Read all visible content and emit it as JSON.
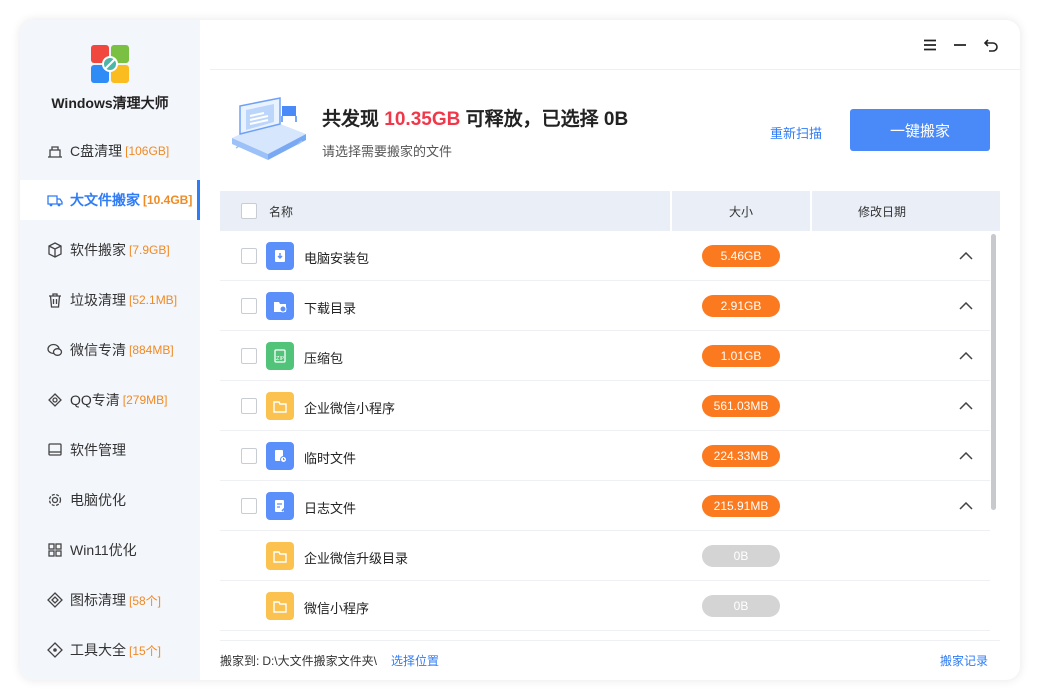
{
  "app": {
    "title": "Windows清理大师"
  },
  "sidebar": {
    "items": [
      {
        "label": "C盘清理",
        "count": "[106GB]",
        "icon": "broom-icon",
        "active": false
      },
      {
        "label": "大文件搬家",
        "count": "[10.4GB]",
        "icon": "truck-icon",
        "active": true
      },
      {
        "label": "软件搬家",
        "count": "[7.9GB]",
        "icon": "box-icon",
        "active": false
      },
      {
        "label": "垃圾清理",
        "count": "[52.1MB]",
        "icon": "trash-icon",
        "active": false
      },
      {
        "label": "微信专清",
        "count": "[884MB]",
        "icon": "wechat-icon",
        "active": false
      },
      {
        "label": "QQ专清",
        "count": "[279MB]",
        "icon": "qq-icon",
        "active": false
      },
      {
        "label": "软件管理",
        "count": "",
        "icon": "monitor-icon",
        "active": false
      },
      {
        "label": "电脑优化",
        "count": "",
        "icon": "gear-icon",
        "active": false
      },
      {
        "label": "Win11优化",
        "count": "",
        "icon": "grid-icon",
        "active": false
      },
      {
        "label": "图标清理",
        "count": "[58个]",
        "icon": "diamond-icon",
        "active": false
      },
      {
        "label": "工具大全",
        "count": "[15个]",
        "icon": "tools-icon",
        "active": false
      }
    ]
  },
  "header": {
    "title_prefix": "共发现 ",
    "title_amount": "10.35GB",
    "title_suffix": " 可释放，已选择 0B",
    "subtitle": "请选择需要搬家的文件",
    "rescan": "重新扫描",
    "primary_button": "一键搬家"
  },
  "table": {
    "columns": {
      "name": "名称",
      "size": "大小",
      "date": "修改日期"
    },
    "rows": [
      {
        "name": "电脑安装包",
        "size": "5.46GB",
        "icon": "installer-icon",
        "icon_color": "#5b8ff9",
        "checkbox": true,
        "expand": true
      },
      {
        "name": "下载目录",
        "size": "2.91GB",
        "icon": "download-folder-icon",
        "icon_color": "#5b8ff9",
        "checkbox": true,
        "expand": true
      },
      {
        "name": "压缩包",
        "size": "1.01GB",
        "icon": "zip-icon",
        "icon_color": "#52c47a",
        "checkbox": true,
        "expand": true
      },
      {
        "name": "企业微信小程序",
        "size": "561.03MB",
        "icon": "folder-icon",
        "icon_color": "#fbc24f",
        "checkbox": true,
        "expand": true
      },
      {
        "name": "临时文件",
        "size": "224.33MB",
        "icon": "temp-file-icon",
        "icon_color": "#5b8ff9",
        "checkbox": true,
        "expand": true
      },
      {
        "name": "日志文件",
        "size": "215.91MB",
        "icon": "log-file-icon",
        "icon_color": "#5b8ff9",
        "checkbox": true,
        "expand": true
      },
      {
        "name": "企业微信升级目录",
        "size": "0B",
        "icon": "folder-icon",
        "icon_color": "#fbc24f",
        "checkbox": false,
        "expand": false
      },
      {
        "name": "微信小程序",
        "size": "0B",
        "icon": "folder-icon",
        "icon_color": "#fbc24f",
        "checkbox": false,
        "expand": false
      }
    ]
  },
  "footer": {
    "move_to_label": "搬家到:",
    "path": "D:\\大文件搬家文件夹\\",
    "choose": "选择位置",
    "history": "搬家记录"
  },
  "colors": {
    "accent": "#2f7cf6",
    "highlight": "#f0384a",
    "size_pill": "#fb7a1f",
    "zero_pill": "#d4d4d4"
  }
}
